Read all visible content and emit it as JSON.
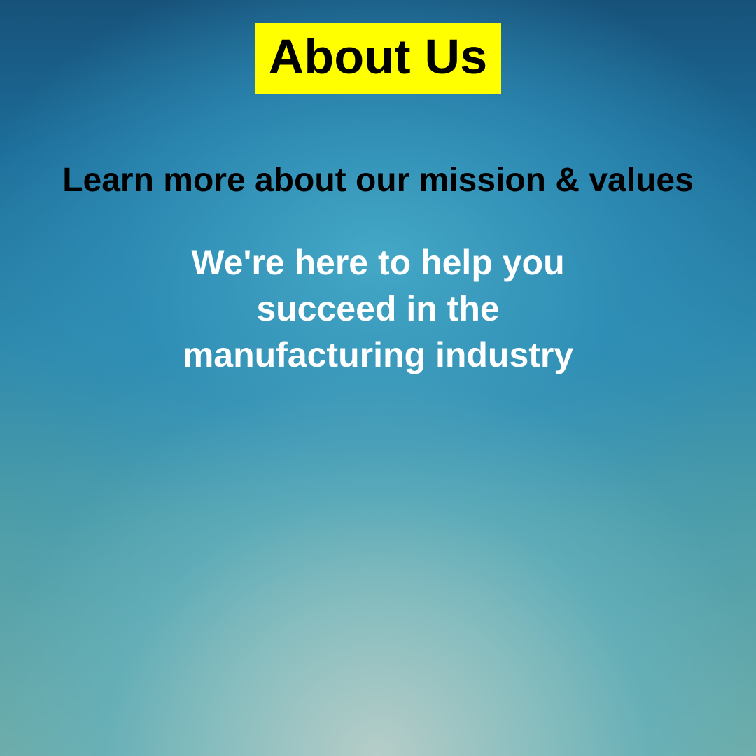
{
  "header": {
    "title": "About Us"
  },
  "content": {
    "subtitle": "Learn more about our mission & values",
    "mission_line_1": "We're here to help you",
    "mission_line_2": "succeed in the",
    "mission_line_3": "manufacturing industry"
  },
  "colors": {
    "title_background": "#ffff00",
    "title_text": "#000000",
    "subtitle_text": "#000000",
    "body_text": "#ffffff",
    "background_top": "#17527a",
    "background_bottom": "#b6cdc8"
  }
}
